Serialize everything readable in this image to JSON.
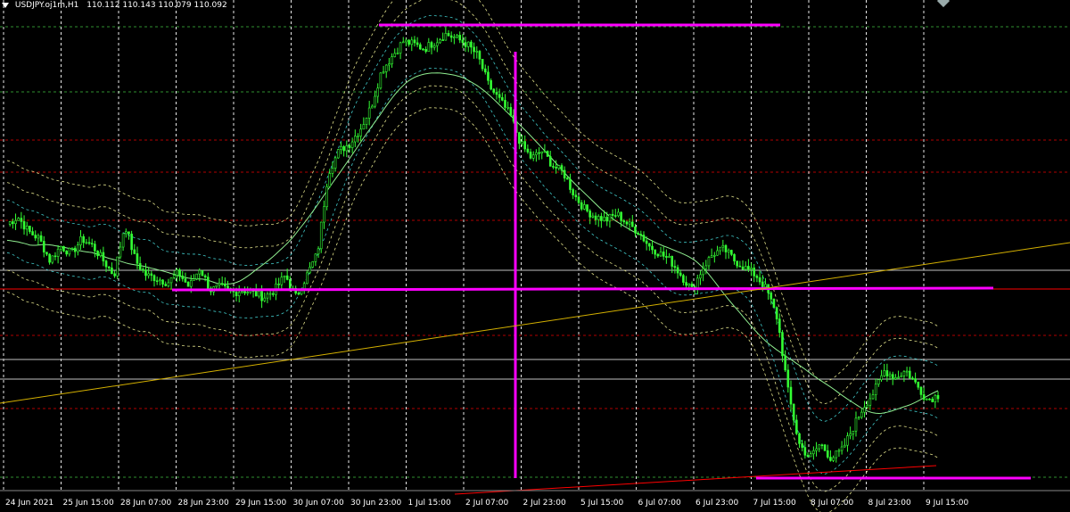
{
  "header": {
    "symbol": "USDJPY.oj1m,H1",
    "quote": "110.112 110.143 110.079 110.092"
  },
  "colors": {
    "background": "#000000",
    "grid": "#ffffff",
    "candles": "#33ff33",
    "ma_long": "#90ee90",
    "bands": "#e0e08a",
    "bands_inner": "#40c8c8",
    "magenta_lines": "#ff00ff",
    "trendline": "#d4b000",
    "red_levels": "#ff0000",
    "gray_levels": "#c0c0c0"
  },
  "x_axis": {
    "labels": [
      "24 Jun 2021",
      "25 Jun 15:00",
      "28 Jun 07:00",
      "28 Jun 23:00",
      "29 Jun 15:00",
      "30 Jun 07:00",
      "30 Jun 23:00",
      "1 Jul 15:00",
      "2 Jul 07:00",
      "2 Jul 23:00",
      "5 Jul 15:00",
      "6 Jul 07:00",
      "6 Jul 23:00",
      "7 Jul 15:00",
      "8 Jul 07:00",
      "8 Jul 23:00",
      "9 Jul 15:00"
    ]
  },
  "chart_data": {
    "type": "candlestick",
    "symbol": "USDJPY.oj1m",
    "timeframe": "H1",
    "last_bar": {
      "open": 110.112,
      "high": 110.143,
      "low": 110.079,
      "close": 110.092
    },
    "close_trace": [
      110.55,
      110.6,
      110.5,
      110.45,
      110.3,
      110.4,
      110.35,
      110.45,
      110.4,
      110.3,
      110.2,
      110.55,
      110.3,
      110.2,
      110.18,
      110.15,
      110.22,
      110.12,
      110.25,
      110.1,
      110.12,
      110.08,
      110.1,
      110.08,
      110.05,
      110.1,
      110.2,
      110.05,
      110.2,
      110.35,
      110.9,
      111.05,
      111.1,
      111.2,
      111.35,
      111.6,
      111.7,
      111.8,
      111.78,
      111.75,
      111.8,
      111.85,
      111.82,
      111.78,
      111.7,
      111.5,
      111.4,
      111.3,
      111.1,
      111.0,
      111.05,
      110.95,
      110.9,
      110.75,
      110.65,
      110.6,
      110.58,
      110.62,
      110.55,
      110.5,
      110.4,
      110.35,
      110.3,
      110.2,
      110.1,
      110.25,
      110.35,
      110.38,
      110.3,
      110.25,
      110.2,
      110.1,
      109.9,
      109.4,
      109.05,
      108.95,
      109.05,
      108.95,
      109.0,
      109.15,
      109.3,
      109.4,
      109.55,
      109.5,
      109.55,
      109.45,
      109.35,
      109.38
    ]
  }
}
